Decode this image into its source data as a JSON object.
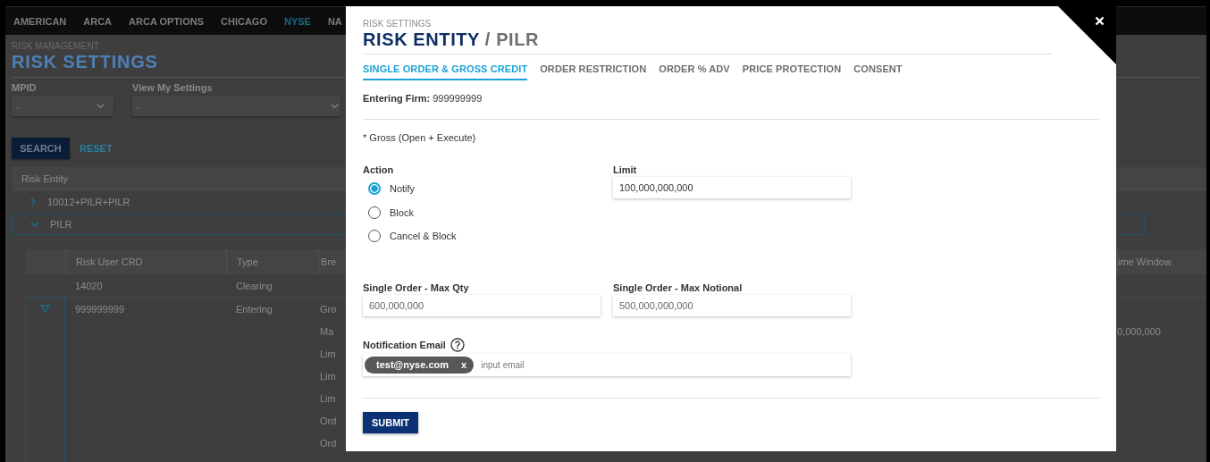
{
  "nav": {
    "items": [
      {
        "label": "AMERICAN",
        "selected": false
      },
      {
        "label": "ARCA",
        "selected": false
      },
      {
        "label": "ARCA OPTIONS",
        "selected": false
      },
      {
        "label": "CHICAGO",
        "selected": false
      },
      {
        "label": "NYSE",
        "selected": true
      },
      {
        "label": "NA",
        "selected": false
      }
    ]
  },
  "page": {
    "breadcrumb": "RISK MANAGEMENT",
    "title": "RISK SETTINGS"
  },
  "filters": [
    {
      "label": "MPID",
      "value": "-"
    },
    {
      "label": "View My Settings",
      "value": "-"
    }
  ],
  "search_button": "SEARCH",
  "reset_link": "RESET",
  "entity_table": {
    "column": "Risk Entity",
    "rows": [
      {
        "label": "10012+PILR+PILR",
        "expanded": false
      },
      {
        "label": "PILR",
        "expanded": true
      }
    ]
  },
  "user_table": {
    "columns": [
      "Risk User CRD",
      "Type",
      "Bre",
      "ime Window"
    ],
    "rows": [
      {
        "expanded": false,
        "crd": "14020",
        "type": "Clearing"
      },
      {
        "expanded": true,
        "crd": "999999999",
        "type": "Entering",
        "sub_rows": [
          {
            "column_3": "Gro"
          },
          {
            "column_3": "Ma",
            "column_4": "0,000,000"
          },
          {
            "column_3": "Lim"
          },
          {
            "column_3": "Lim"
          },
          {
            "column_3": "Lim"
          },
          {
            "column_3": "Ord"
          },
          {
            "column_3": "Ord"
          }
        ]
      }
    ]
  },
  "modal": {
    "breadcrumb": "RISK SETTINGS",
    "title": "RISK ENTITY",
    "subtitle": "/ PILR",
    "tabs": [
      {
        "label": "SINGLE ORDER & GROSS CREDIT",
        "selected": true
      },
      {
        "label": "ORDER RESTRICTION",
        "selected": false
      },
      {
        "label": "ORDER % ADV",
        "selected": false
      },
      {
        "label": "PRICE PROTECTION",
        "selected": false
      },
      {
        "label": "CONSENT",
        "selected": false
      }
    ],
    "entering_firm": {
      "label": "Entering Firm:",
      "value": "999999999"
    },
    "note": "* Gross (Open + Execute)",
    "action": {
      "label": "Action",
      "options": [
        {
          "label": "Notify",
          "selected": true
        },
        {
          "label": "Block",
          "selected": false
        },
        {
          "label": "Cancel & Block",
          "selected": false
        }
      ]
    },
    "limit": {
      "label": "Limit",
      "value": "100,000,000,000"
    },
    "max_qty": {
      "label": "Single Order - Max Qty",
      "value": "600,000,000"
    },
    "max_notional": {
      "label": "Single Order - Max Notional",
      "value": "500,000,000,000"
    },
    "notification_email": {
      "label": "Notification Email",
      "tags": [
        {
          "text": "test@nyse.com",
          "remove": "x"
        }
      ],
      "placeholder": "input email"
    },
    "submit": "SUBMIT"
  }
}
